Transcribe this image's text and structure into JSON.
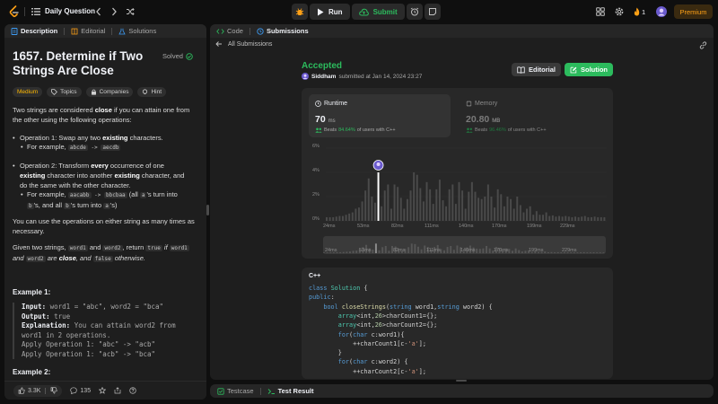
{
  "header": {
    "title": "Daily Question",
    "run_label": "Run",
    "submit_label": "Submit",
    "streak_count": "1",
    "premium_label": "Premium"
  },
  "left_panel": {
    "tabs": [
      {
        "label": "Description"
      },
      {
        "label": "Editorial"
      },
      {
        "label": "Solutions"
      }
    ],
    "problem_title": "1657. Determine if Two Strings Are Close",
    "solved_label": "Solved",
    "tags": {
      "difficulty": "Medium",
      "topics": "Topics",
      "companies": "Companies",
      "hint": "Hint"
    },
    "intro_a": "Two strings are considered ",
    "intro_b": "close",
    "intro_c": " if you can attain one from the other using the following operations:",
    "op1_a": "Operation 1: Swap any two ",
    "op1_b": "existing",
    "op1_c": " characters.",
    "op1_ex_a": "For example, ",
    "op1_ex_code1": "abcde",
    "op1_ex_arrow": " -> ",
    "op1_ex_code2": "aecdb",
    "op2_a": "Operation 2: Transform ",
    "op2_b": "every",
    "op2_c": " occurrence of one",
    "op2_d": "existing",
    "op2_e": " character into another ",
    "op2_f": "existing",
    "op2_g": " character, and",
    "op2_h": "do the same with the other character.",
    "op2_ex_a": "For example, ",
    "op2_ex_code1": "aacabb",
    "op2_ex_arrow": " -> ",
    "op2_ex_code2": "bbcbaa",
    "op2_ex_b": " (all ",
    "op2_ex_code3": "a",
    "op2_ex_c": "'s turn into",
    "op2_ex_code4": "b",
    "op2_ex_d": "'s, and all ",
    "op2_ex_code5": "b",
    "op2_ex_e": "'s turn into ",
    "op2_ex_code6": "a",
    "op2_ex_f": "'s)",
    "note1": "You can use the operations on either string as many times as",
    "note2": "necessary.",
    "given_a": "Given two strings, ",
    "given_c1": "word1",
    "given_b": " and ",
    "given_c2": "word2",
    "given_d": ", return ",
    "given_c3": "true",
    "given_e": " if ",
    "given_c4": "word1",
    "given_f": "and ",
    "given_c5": "word2",
    "given_g": " are ",
    "given_h": "close",
    "given_i": ", and ",
    "given_c6": "false",
    "given_j": " otherwise.",
    "example1_title": "Example 1:",
    "ex1_input_label": "Input:",
    "ex1_input_val": " word1 = \"abc\", word2 = \"bca\"",
    "ex1_output_label": "Output:",
    "ex1_output_val": " true",
    "ex1_expl_label": "Explanation:",
    "ex1_expl_val": " You can attain word2 from",
    "ex1_expl_val2": "word1 in 2 operations.",
    "ex1_apply1": "Apply Operation 1: \"abc\" -> \"acb\"",
    "ex1_apply2": "Apply Operation 1: \"acb\" -> \"bca\"",
    "example2_title": "Example 2:",
    "likes": "3.3K",
    "comments": "135"
  },
  "right_panel": {
    "tabs": [
      {
        "label": "Code"
      },
      {
        "label": "Submissions"
      }
    ],
    "back_label": "All Submissions",
    "status": "Accepted",
    "user": "Siddham",
    "submitted_text": "submitted at Jan 14, 2024 23:27",
    "editorial_btn": "Editorial",
    "solution_btn": "Solution",
    "runtime_label": "Runtime",
    "runtime_value": "70",
    "runtime_unit": "ms",
    "runtime_beats_a": "Beats ",
    "runtime_beats_pct": "84.64%",
    "runtime_beats_b": " of users with C++",
    "memory_label": "Memory",
    "memory_value": "20.80",
    "memory_unit": "MB",
    "memory_beats_a": "Beats ",
    "memory_beats_pct": "96.46%",
    "memory_beats_b": " of users with C++",
    "code_lang": "C++",
    "code_lines": [
      "class Solution {",
      "public:",
      "    bool closeStrings(string word1,string word2) {",
      "        array<int,26>charCount1={};",
      "        array<int,26>charCount2={};",
      "        for(char c:word1){",
      "            ++charCount1[c-'a'];",
      "        }",
      "        for(char c:word2) {",
      "            ++charCount2[c-'a'];"
    ],
    "bottom_tabs": [
      {
        "label": "Testcase"
      },
      {
        "label": "Test Result"
      }
    ]
  },
  "chart_data": {
    "type": "bar",
    "y_ticks": [
      "6%",
      "4%",
      "2%",
      "0%"
    ],
    "ylim": [
      0,
      6
    ],
    "x_tick_labels": [
      "24ms",
      "53ms",
      "82ms",
      "111ms",
      "140ms",
      "170ms",
      "199ms",
      "229ms"
    ],
    "mini_x_tick_labels": [
      "24ms",
      "53ms",
      "82ms",
      "111ms",
      "140ms",
      "170ms",
      "199ms",
      "229ms"
    ],
    "highlight_index": 16,
    "highlight_value": 4.0,
    "values": [
      0.3,
      0.3,
      0.3,
      0.35,
      0.4,
      0.4,
      0.5,
      0.6,
      0.7,
      1.0,
      1.1,
      1.6,
      2.5,
      3.5,
      2.0,
      1.5,
      4.0,
      1.2,
      2.5,
      3.0,
      1.0,
      3.0,
      2.8,
      1.9,
      1.0,
      1.8,
      2.5,
      4.0,
      3.8,
      2.7,
      1.6,
      3.2,
      2.6,
      1.4,
      2.6,
      3.4,
      1.7,
      1.2,
      2.6,
      3.0,
      1.4,
      3.2,
      2.5,
      1.0,
      2.4,
      3.2,
      2.4,
      1.9,
      1.8,
      2.0,
      3.0,
      2.0,
      1.1,
      2.6,
      2.2,
      1.2,
      2.0,
      1.8,
      1.0,
      2.0,
      1.3,
      0.7,
      1.0,
      1.2,
      0.5,
      0.8,
      0.5,
      0.5,
      0.7,
      0.4,
      0.45,
      0.35,
      0.4,
      0.35,
      0.4,
      0.35,
      0.3,
      0.35,
      0.3,
      0.35,
      0.4,
      0.3,
      0.3,
      0.35,
      0.3,
      0.3,
      0.3
    ]
  },
  "colors": {
    "accent_green": "#2cbb5d",
    "premium_orange": "#ffa116",
    "medium_yellow": "#ffb800",
    "bar_grey": "#4a4a4a",
    "highlight_bar": "#ffffff"
  }
}
